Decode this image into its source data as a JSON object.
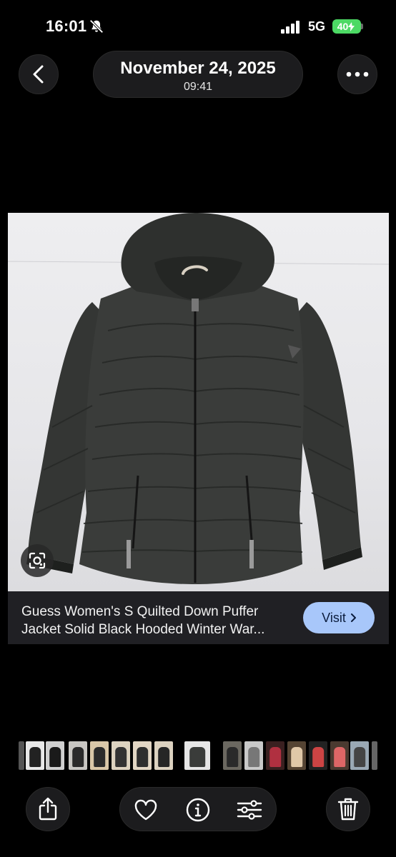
{
  "status_bar": {
    "time": "16:01",
    "network": "5G",
    "battery": "40"
  },
  "header": {
    "date": "November 24, 2025",
    "time": "09:41"
  },
  "result": {
    "title_line1": "Guess Women's S Quilted Down Puffer",
    "title_line2": "Jacket Solid Black Hooded Winter War...",
    "visit_label": "Visit"
  },
  "icons": {
    "back": "chevron-left-icon",
    "more": "ellipsis-icon",
    "lens": "lens-search-icon",
    "share": "share-icon",
    "favorite": "heart-icon",
    "info": "info-icon",
    "adjust": "sliders-icon",
    "delete": "trash-icon",
    "silent": "bell-slash-icon"
  },
  "colors": {
    "background": "#000000",
    "visit_button": "#a8c7fa",
    "battery": "#4cd964"
  }
}
